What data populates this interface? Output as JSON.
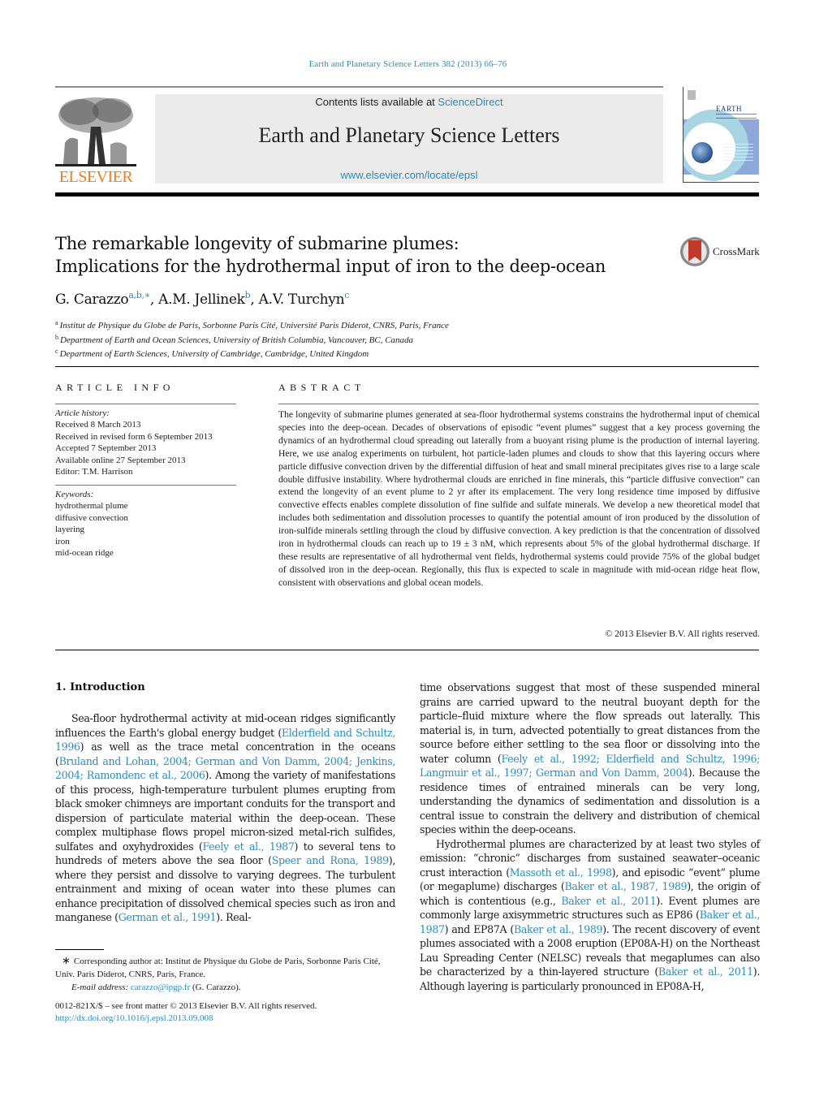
{
  "header": {
    "citation": "Earth and Planetary Science Letters 382 (2013) 66–76",
    "contents_prefix": "Contents lists available at ",
    "contents_link": "ScienceDirect",
    "journal_name": "Earth and Planetary Science Letters",
    "journal_url": "www.elsevier.com/locate/epsl",
    "publisher_logo_text": "ELSEVIER",
    "cover_title": "EARTH",
    "crossmark_label": "CrossMark"
  },
  "colors": {
    "link": "#2a8cba",
    "elsevier_orange": "#ef7d1a",
    "banner_gray": "#ebebeb"
  },
  "article": {
    "title_line1": "The remarkable longevity of submarine plumes:",
    "title_line2": "Implications for the hydrothermal input of iron to the deep-ocean",
    "authors": [
      {
        "name": "G. Carazzo",
        "marks": "a,b,∗",
        "sep": ", "
      },
      {
        "name": "A.M. Jellinek",
        "marks": "b",
        "sep": ", "
      },
      {
        "name": "A.V. Turchyn",
        "marks": "c",
        "sep": ""
      }
    ],
    "affiliations": [
      {
        "mark": "a",
        "text": "Institut de Physique du Globe de Paris, Sorbonne Paris Cité, Université Paris Diderot, CNRS, Paris, France"
      },
      {
        "mark": "b",
        "text": "Department of Earth and Ocean Sciences, University of British Columbia, Vancouver, BC, Canada"
      },
      {
        "mark": "c",
        "text": "Department of Earth Sciences, University of Cambridge, Cambridge, United Kingdom"
      }
    ]
  },
  "article_info": {
    "heading": "ARTICLE INFO",
    "history_label": "Article history:",
    "history": [
      "Received 8 March 2013",
      "Received in revised form 6 September 2013",
      "Accepted 7 September 2013",
      "Available online 27 September 2013",
      "Editor: T.M. Harrison"
    ],
    "keywords_label": "Keywords:",
    "keywords": [
      "hydrothermal plume",
      "diffusive convection",
      "layering",
      "iron",
      "mid-ocean ridge"
    ]
  },
  "abstract": {
    "heading": "ABSTRACT",
    "text": "The longevity of submarine plumes generated at sea-floor hydrothermal systems constrains the hydrothermal input of chemical species into the deep-ocean. Decades of observations of episodic “event plumes” suggest that a key process governing the dynamics of an hydrothermal cloud spreading out laterally from a buoyant rising plume is the production of internal layering. Here, we use analog experiments on turbulent, hot particle-laden plumes and clouds to show that this layering occurs where particle diffusive convection driven by the differential diffusion of heat and small mineral precipitates gives rise to a large scale double diffusive instability. Where hydrothermal clouds are enriched in fine minerals, this “particle diffusive convection” can extend the longevity of an event plume to 2 yr after its emplacement. The very long residence time imposed by diffusive convective effects enables complete dissolution of fine sulfide and sulfate minerals. We develop a new theoretical model that includes both sedimentation and dissolution processes to quantify the potential amount of iron produced by the dissolution of iron-sulfide minerals settling through the cloud by diffusive convection. A key prediction is that the concentration of dissolved iron in hydrothermal clouds can reach up to 19 ± 3 nM, which represents about 5% of the global hydrothermal discharge. If these results are representative of all hydrothermal vent fields, hydrothermal systems could provide 75% of the global budget of dissolved iron in the deep-ocean. Regionally, this flux is expected to scale in magnitude with mid-ocean ridge heat flow, consistent with observations and global ocean models.",
    "copyright": "© 2013 Elsevier B.V. All rights reserved."
  },
  "body": {
    "section_heading": "1. Introduction",
    "left_paragraph": [
      {
        "t": "Sea-floor hydrothermal activity at mid-ocean ridges significantly influences the Earth's global energy budget ("
      },
      {
        "l": "Elderfield and Schultz, 1996"
      },
      {
        "t": ") as well as the trace metal concentration in the oceans ("
      },
      {
        "l": "Bruland and Lohan, 2004; German and Von Damm, 2004; Jenkins, 2004; Ramondenc et al., 2006"
      },
      {
        "t": "). Among the variety of manifestations of this process, high-temperature turbulent plumes erupting from black smoker chimneys are important conduits for the transport and dispersion of particulate material within the deep-ocean. These complex multiphase flows propel micron-sized metal-rich sulfides, sulfates and oxyhydroxides ("
      },
      {
        "l": "Feely et al., 1987"
      },
      {
        "t": ") to several tens to hundreds of meters above the sea floor ("
      },
      {
        "l": "Speer and Rona, 1989"
      },
      {
        "t": "), where they persist and dissolve to varying degrees. The turbulent entrainment and mixing of ocean water into these plumes can enhance precipitation of dissolved chemical species such as iron and manganese ("
      },
      {
        "l": "German et al., 1991"
      },
      {
        "t": "). Real-"
      }
    ],
    "right_paragraph_1": [
      {
        "t": "time observations suggest that most of these suspended mineral grains are carried upward to the neutral buoyant depth for the particle–fluid mixture where the flow spreads out laterally. This material is, in turn, advected potentially to great distances from the source before either settling to the sea floor or dissolving into the water column ("
      },
      {
        "l": "Feely et al., 1992; Elderfield and Schultz, 1996; Langmuir et al., 1997; German and Von Damm, 2004"
      },
      {
        "t": "). Because the residence times of entrained minerals can be very long, understanding the dynamics of sedimentation and dissolution is a central issue to constrain the delivery and distribution of chemical species within the deep-oceans."
      }
    ],
    "right_paragraph_2": [
      {
        "t": "Hydrothermal plumes are characterized by at least two styles of emission: “chronic” discharges from sustained seawater–oceanic crust interaction ("
      },
      {
        "l": "Massoth et al., 1998"
      },
      {
        "t": "), and episodic “event” plume (or megaplume) discharges ("
      },
      {
        "l": "Baker et al., 1987, 1989"
      },
      {
        "t": "), the origin of which is contentious (e.g., "
      },
      {
        "l": "Baker et al., 2011"
      },
      {
        "t": "). Event plumes are commonly large axisymmetric structures such as EP86 ("
      },
      {
        "l": "Baker et al., 1987"
      },
      {
        "t": ") and EP87A ("
      },
      {
        "l": "Baker et al., 1989"
      },
      {
        "t": "). The recent discovery of event plumes associated with a 2008 eruption (EP08A-H) on the Northeast Lau Spreading Center (NELSC) reveals that megaplumes can also be characterized by a thin-layered structure ("
      },
      {
        "l": "Baker et al., 2011"
      },
      {
        "t": "). Although layering is particularly pronounced in EP08A-H,"
      }
    ]
  },
  "footnote": {
    "star": "∗",
    "corresponding": "Corresponding author at: Institut de Physique du Globe de Paris, Sorbonne Paris Cité, Univ. Paris Diderot, CNRS, Paris, France.",
    "email_label": "E-mail address:",
    "email": "carazzo@ipgp.fr",
    "email_suffix": " (G. Carazzo)."
  },
  "front_matter": {
    "issn_line": "0012-821X/$ – see front matter  © 2013 Elsevier B.V. All rights reserved.",
    "doi": "http://dx.doi.org/10.1016/j.epsl.2013.09.008"
  }
}
